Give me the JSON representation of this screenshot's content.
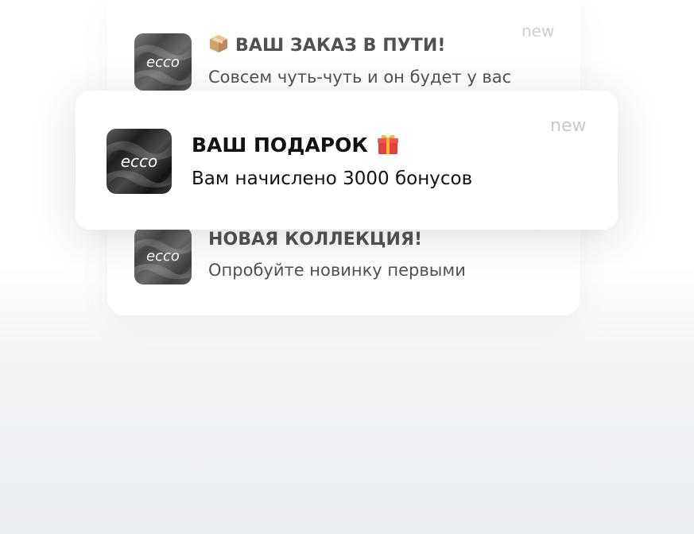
{
  "notifications": [
    {
      "id": "order",
      "emoji_icon": "package-emoji",
      "title": "ВАШ ЗАКАЗ В ПУТИ!",
      "body": "Совсем чуть-чуть и он будет у вас",
      "badge": "new",
      "logo_text": "ecco"
    },
    {
      "id": "gift",
      "emoji_icon": "gift-emoji",
      "title": "ВАШ ПОДАРОК",
      "body": "Вам начислено 3000 бонусов",
      "badge": "new",
      "logo_text": "ecco"
    },
    {
      "id": "collection",
      "title": "НОВАЯ КОЛЛЕКЦИЯ!",
      "body": "Опробуйте новинку первыми",
      "badge": "new",
      "logo_text": "ecco"
    }
  ],
  "colors": {
    "logo_dark": "#1a1a1a",
    "logo_light": "#6b6b6b",
    "badge_gray": "#c9c9c9",
    "gift_red": "#e3413b",
    "gift_ribbon": "#f5b52e",
    "package_brown": "#c98d4a"
  }
}
